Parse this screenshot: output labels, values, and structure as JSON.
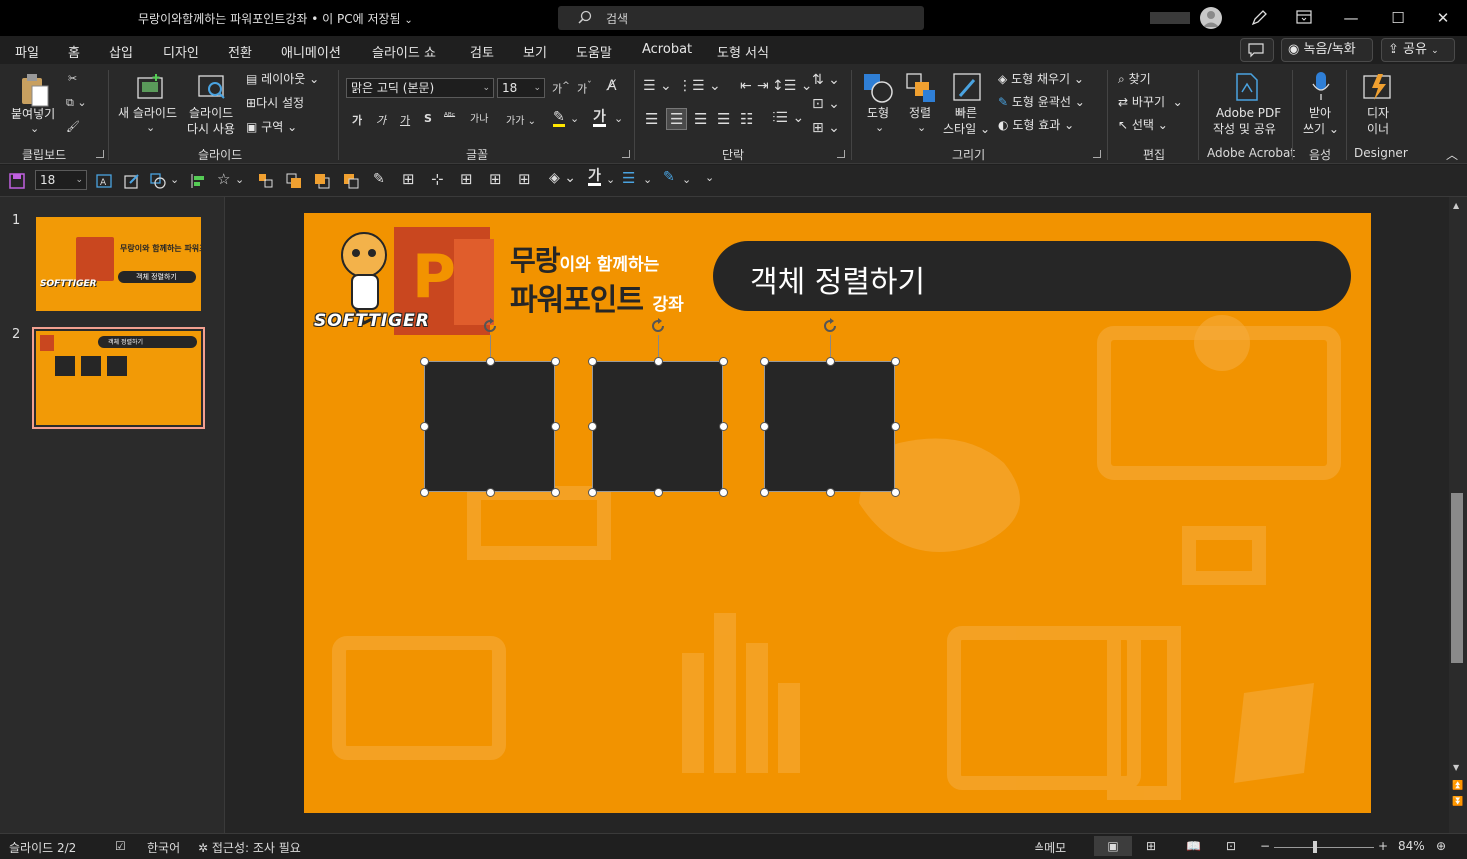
{
  "window": {
    "title": "무랑이와함께하는 파워포인트강좌 • 이 PC에 저장됨",
    "search_placeholder": "검색",
    "controls": [
      "minimize",
      "restore",
      "close"
    ]
  },
  "tabs": [
    {
      "label": "파일"
    },
    {
      "label": "홈",
      "active": true
    },
    {
      "label": "삽입"
    },
    {
      "label": "디자인"
    },
    {
      "label": "전환"
    },
    {
      "label": "애니메이션"
    },
    {
      "label": "슬라이드 쇼"
    },
    {
      "label": "검토"
    },
    {
      "label": "보기"
    },
    {
      "label": "도움말"
    },
    {
      "label": "Acrobat"
    },
    {
      "label": "도형 서식"
    }
  ],
  "header_buttons": {
    "record": "녹음/녹화",
    "share": "공유"
  },
  "ribbon": {
    "clipboard": {
      "paste": "붙여넣기",
      "group": "클립보드"
    },
    "slides": {
      "new_slide": "새 슬라이드",
      "reuse_l1": "슬라이드",
      "reuse_l2": "다시 사용",
      "layout": "레이아웃",
      "reset": "다시 설정",
      "section": "구역",
      "group": "슬라이드"
    },
    "font": {
      "name": "맑은 고딕 (본문)",
      "size": "18",
      "bold": "가",
      "italic": "가",
      "underline": "가",
      "strike": "S",
      "spacing": "가나",
      "case": "가가",
      "shadow": "가",
      "group": "글꼴"
    },
    "paragraph": {
      "group": "단락"
    },
    "drawing": {
      "shapes": "도형",
      "arrange": "정렬",
      "quick_l1": "빠른",
      "quick_l2": "스타일",
      "fill": "도형 채우기",
      "outline": "도형 윤곽선",
      "effects": "도형 효과",
      "group": "그리기"
    },
    "editing": {
      "find": "찾기",
      "replace": "바꾸기",
      "select": "선택",
      "group": "편집"
    },
    "acrobat": {
      "l1": "Adobe PDF",
      "l2": "작성 및 공유",
      "group": "Adobe Acrobat"
    },
    "voice": {
      "l1": "받아",
      "l2": "쓰기",
      "group": "음성"
    },
    "designer": {
      "l1": "디자",
      "l2": "이너",
      "group": "Designer"
    }
  },
  "qat": {
    "font_size": "18"
  },
  "thumbnails": [
    {
      "number": "1",
      "title": "무랑이와 함께하는 파워포인트 강좌",
      "subtitle": "객체 정렬하기",
      "selected": false
    },
    {
      "number": "2",
      "title": "객체 정렬하기",
      "selected": true
    }
  ],
  "slide": {
    "brand_top": "무랑",
    "brand_top_white": "이와 함께하는",
    "brand_bottom": "파워포인트",
    "brand_bottom_white": "강좌",
    "logo_text": "SOFTTIGER",
    "title": "객체 정렬하기",
    "background": "#f29300",
    "shape_color": "#262626",
    "selected_shapes": 3
  },
  "status": {
    "slide": "슬라이드 2/2",
    "language": "한국어",
    "accessibility": "접근성: 조사 필요",
    "notes": "메모",
    "zoom": "84%"
  }
}
